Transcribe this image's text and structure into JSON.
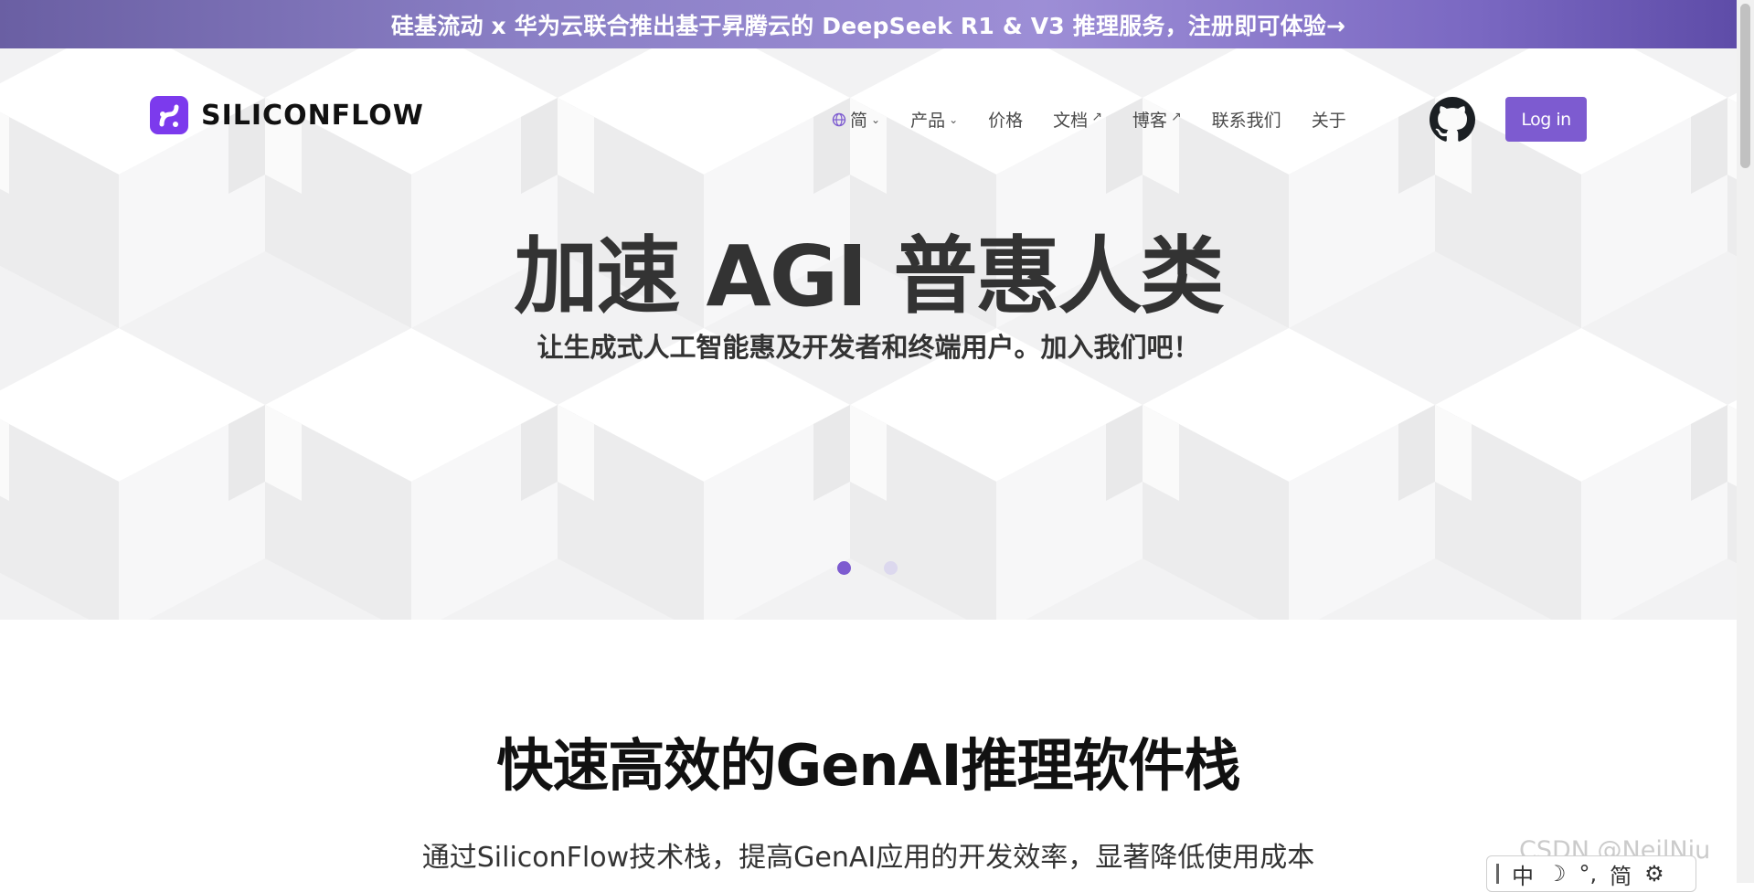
{
  "banner": {
    "text": "硅基流动 x 华为云联合推出基于昇腾云的 DeepSeek R1 & V3 推理服务，注册即可体验→"
  },
  "logo": {
    "text": "SILICONFLOW"
  },
  "nav": {
    "items": [
      {
        "label": "简",
        "icon": "globe-icon",
        "dropdown": true
      },
      {
        "label": "产品",
        "dropdown": true
      },
      {
        "label": "价格"
      },
      {
        "label": "文档",
        "external": true
      },
      {
        "label": "博客",
        "external": true
      },
      {
        "label": "联系我们"
      },
      {
        "label": "关于"
      }
    ],
    "github_icon": "github-icon",
    "login_label": "Log in"
  },
  "hero": {
    "title": "加速 AGI 普惠人类",
    "subtitle": "让生成式人工智能惠及开发者和终端用户。加入我们吧！",
    "slide_count": 2,
    "active_slide": 1
  },
  "section": {
    "title": "快速高效的GenAI推理软件栈",
    "subtitle": "通过SiliconFlow技术栈，提高GenAI应用的开发效率，显著降低使用成本"
  },
  "watermark": "CSDN @NeilNiu",
  "ime": {
    "lang": "中",
    "moon_icon": "moon-icon",
    "punct": "°,",
    "mode": "简",
    "settings_icon": "gear-icon"
  },
  "colors": {
    "accent": "#7d5bd0",
    "banner_start": "#6a5fa3",
    "banner_end": "#5e4ca8"
  }
}
